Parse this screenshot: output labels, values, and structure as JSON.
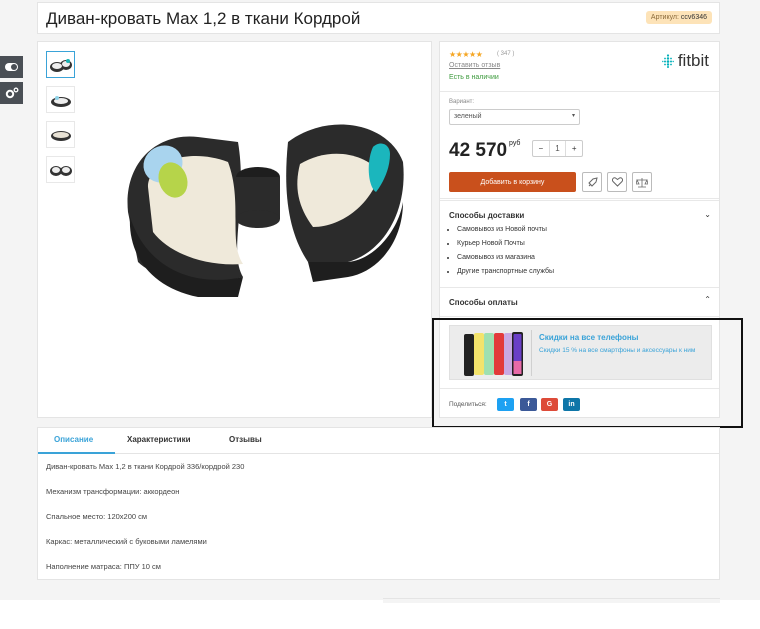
{
  "product": {
    "title": "Диван-кровать Max 1,2 в ткани Кордрой",
    "sku_label": "Артикул:",
    "sku_value": "ccv6346"
  },
  "rating": {
    "stars": "★★★★★",
    "count": "( 347 )",
    "review_link": "Оставить отзыв",
    "stock": "Есть в наличии"
  },
  "brand": {
    "name": "fitbit"
  },
  "purchase": {
    "variant_label": "Вариант:",
    "variant_value": "зеленый",
    "price": "42 570",
    "currency": "руб",
    "qty_minus": "−",
    "qty_value": "1",
    "qty_plus": "+",
    "add_to_cart": "Добавить в корзину"
  },
  "delivery": {
    "title": "Способы доставки",
    "items": [
      "Самовывоз из Новой почты",
      "Курьер Новой Почты",
      "Самовывоз из магазина",
      "Другие транспортные службы"
    ]
  },
  "payment": {
    "title": "Способы оплаты"
  },
  "promo": {
    "title": "Скидки на все телефоны",
    "subtitle": "Скидки 15 % на все смартфоны и аксессуары к ним"
  },
  "share": {
    "label": "Поделиться:",
    "buttons": [
      "t",
      "f",
      "G",
      "in"
    ]
  },
  "tabs": [
    "Описание",
    "Характеристики",
    "Отзывы"
  ],
  "description": [
    "Диван-кровать Max 1,2  в ткани Кордрой 336/кордрой 230",
    "Механизм трансформации: аккордеон",
    "Спальное место: 120х200 см",
    "Каркас: металлический с буковыми ламелями",
    "Наполнение матраса: ППУ 10 см"
  ],
  "colors": {
    "accent": "#3aa3d8",
    "cart": "#c9501c",
    "stock": "#3c9a3c",
    "star": "#f5a623",
    "twitter": "#1da1f2",
    "facebook": "#3b5998",
    "google": "#dd4b39",
    "linkedin": "#0e76a8"
  }
}
